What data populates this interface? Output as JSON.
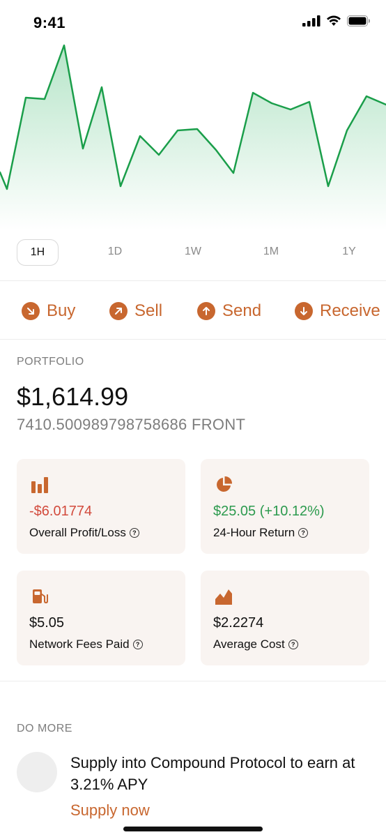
{
  "status_bar": {
    "time": "9:41"
  },
  "chart": {
    "line_color": "#1a9e4a",
    "fill_color": "#2fb463"
  },
  "time_ranges": [
    "1H",
    "1D",
    "1W",
    "1M",
    "1Y"
  ],
  "active_range": "1H",
  "actions": {
    "buy": "Buy",
    "sell": "Sell",
    "send": "Send",
    "receive": "Receive",
    "accent": "#c8672f"
  },
  "portfolio": {
    "section_label": "PORTFOLIO",
    "balance": "$1,614.99",
    "token_amount": "7410.500989798758686 FRONT"
  },
  "stats": {
    "profit_loss": {
      "value": "-$6.01774",
      "label": "Overall Profit/Loss",
      "icon": "bar-chart-icon"
    },
    "return_24h": {
      "value": "$25.05 (+10.12%)",
      "label": "24-Hour Return",
      "icon": "pie-chart-icon"
    },
    "network_fees": {
      "value": "$5.05",
      "label": "Network Fees Paid",
      "icon": "fuel-pump-icon"
    },
    "average_cost": {
      "value": "$2.2274",
      "label": "Average Cost",
      "icon": "area-chart-icon"
    },
    "help_glyph": "?"
  },
  "do_more": {
    "section_label": "DO MORE",
    "promo_text": "Supply into Compound Protocol to earn at 3.21% APY",
    "promo_link": "Supply now"
  }
}
